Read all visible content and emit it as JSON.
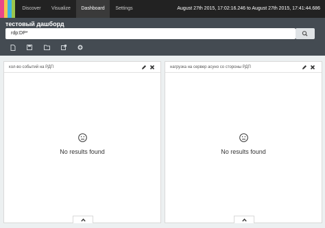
{
  "nav": {
    "items": [
      "Discover",
      "Visualize",
      "Dashboard",
      "Settings"
    ],
    "active": "Dashboard",
    "logo_colors": [
      "#e8478b",
      "#f3c64c",
      "#3cb4e5",
      "#9ac64d",
      "#1f1f1f"
    ],
    "time_range": "August 27th 2015, 17:02:16.246 to August 27th 2015, 17:41:44.686"
  },
  "dashboard": {
    "title": "тестовый дашборд",
    "query": "rdp:DP*",
    "toolbar_icons": [
      "new-dashboard-icon",
      "save-icon",
      "open-icon",
      "share-icon",
      "add-visualization-icon"
    ]
  },
  "panels": [
    {
      "title": "кол-во событий на РДП",
      "empty_text": "No results found"
    },
    {
      "title": "нагрузка на сервер асуно со стороны РДП",
      "empty_text": "No results found"
    }
  ],
  "colors": {
    "nav_bg": "#222222",
    "header_bg": "#444b52",
    "page_bg": "#ecf0f1"
  }
}
